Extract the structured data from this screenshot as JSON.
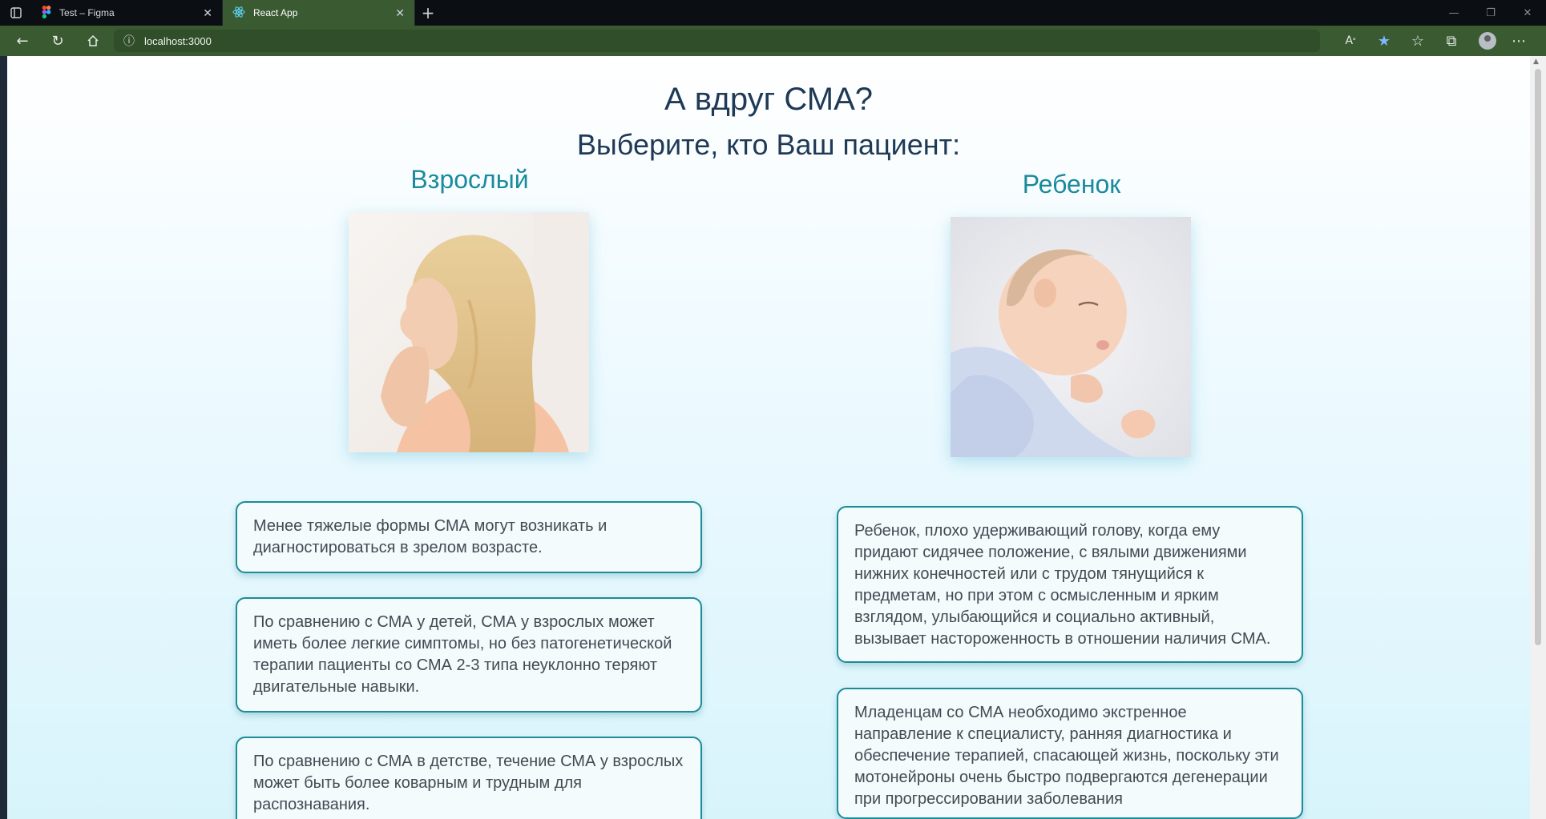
{
  "browser": {
    "tabs": [
      {
        "title": "Test – Figma",
        "icon": "figma-icon"
      },
      {
        "title": "React App",
        "icon": "react-icon",
        "active": true
      }
    ],
    "url": "localhost:3000"
  },
  "page": {
    "heading": "А вдруг СМА?",
    "subheading": "Выберите, кто Ваш пациент:",
    "adult": {
      "title": "Взрослый",
      "cards": [
        "Менее тяжелые формы СМА могут возникать и диагностироваться в зрелом возрасте.",
        " По сравнению с СМА у детей, СМА у взрослых может иметь более легкие симптомы, но без патогенетической терапии пациенты со СМА 2-3 типа неуклонно теряют двигательные навыки.",
        "По сравнению с СМА в детстве, течение СМА у взрослых может быть более коварным и трудным для распознавания."
      ]
    },
    "child": {
      "title": "Ребенок",
      "cards": [
        " Ребенок, плохо удерживающий голову, когда ему придают сидячее положение, с вялыми движениями нижних конечностей или с трудом тянущийся к предметам, но при этом с осмысленным и ярким взглядом, улыбающийся и социально активный, вызывает настороженность в отношении наличия СМА.",
        " Младенцам со СМА необходимо экстренное направление к специалисту, ранняя диагностика и обеспечение терапией, спасающей жизнь, поскольку эти мотонейроны очень быстро подвергаются дегенерации при прогрессировании заболевания"
      ]
    },
    "colors": {
      "heading": "#1f3a56",
      "accent": "#1a8a9c",
      "card_border": "#1a8c9a"
    }
  }
}
